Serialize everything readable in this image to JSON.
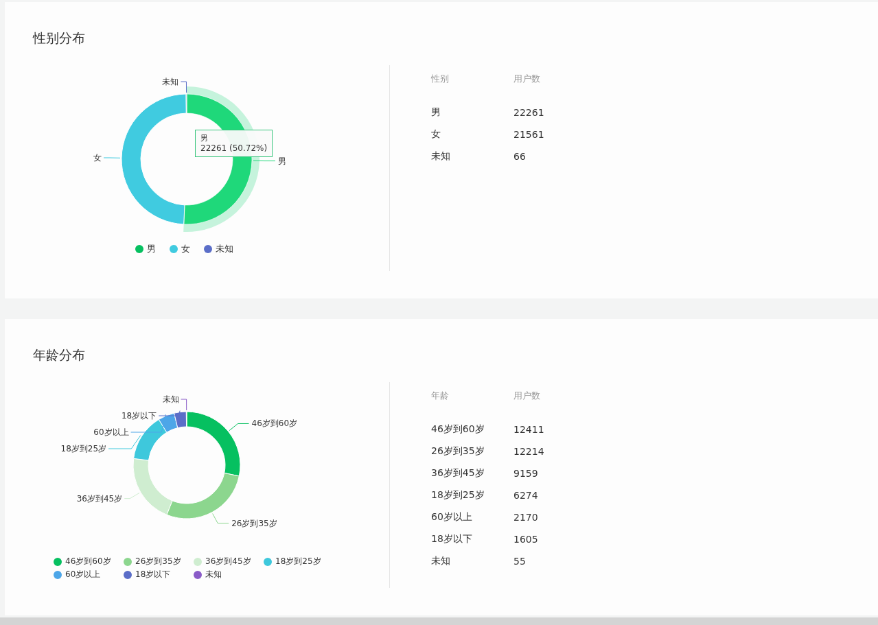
{
  "sections": [
    {
      "title": "性别分布",
      "chart": {
        "chart_data": {
          "type": "donut",
          "categories": [
            "男",
            "女",
            "未知"
          ],
          "values": [
            50.72,
            49.13,
            0.15
          ],
          "colors": [
            "#1fd87a",
            "#40cbe0",
            "#5b6ec8"
          ]
        },
        "highlighted": [
          true,
          false,
          false
        ],
        "tooltip": {
          "title": "男",
          "text": "22261 (50.72%)"
        },
        "legend": [
          {
            "label": "男",
            "color": "#06c060"
          },
          {
            "label": "女",
            "color": "#40cbe0"
          },
          {
            "label": "未知",
            "color": "#5b6ec8"
          }
        ]
      },
      "table": {
        "columns": [
          "性别",
          "用户数"
        ],
        "rows": [
          [
            "男",
            "22261"
          ],
          [
            "女",
            "21561"
          ],
          [
            "未知",
            "66"
          ]
        ]
      }
    },
    {
      "title": "年龄分布",
      "chart": {
        "chart_data": {
          "type": "donut",
          "categories": [
            "46岁到60岁",
            "26岁到35岁",
            "36岁到45岁",
            "18岁到25岁",
            "60岁以上",
            "18岁以下",
            "未知"
          ],
          "values": [
            28.28,
            27.83,
            20.87,
            14.29,
            4.94,
            3.66,
            0.13
          ],
          "colors": [
            "#06c060",
            "#8cd68e",
            "#cfedd0",
            "#3ec8dc",
            "#4da6e8",
            "#5b6ec8",
            "#8a5cc8"
          ]
        },
        "highlighted": [
          false,
          false,
          false,
          false,
          false,
          false,
          false
        ],
        "legend": [
          {
            "label": "46岁到60岁",
            "color": "#06c060"
          },
          {
            "label": "26岁到35岁",
            "color": "#8cd68e"
          },
          {
            "label": "36岁到45岁",
            "color": "#cfedd0"
          },
          {
            "label": "18岁到25岁",
            "color": "#3ec8dc"
          },
          {
            "label": "60岁以上",
            "color": "#4da6e8"
          },
          {
            "label": "18岁以下",
            "color": "#5b6ec8"
          },
          {
            "label": "未知",
            "color": "#8a5cc8"
          }
        ]
      },
      "table": {
        "columns": [
          "年龄",
          "用户数"
        ],
        "rows": [
          [
            "46岁到60岁",
            "12411"
          ],
          [
            "26岁到35岁",
            "12214"
          ],
          [
            "36岁到45岁",
            "9159"
          ],
          [
            "18岁到25岁",
            "6274"
          ],
          [
            "60岁以上",
            "2170"
          ],
          [
            "18岁以下",
            "1605"
          ],
          [
            "未知",
            "55"
          ]
        ]
      }
    }
  ]
}
